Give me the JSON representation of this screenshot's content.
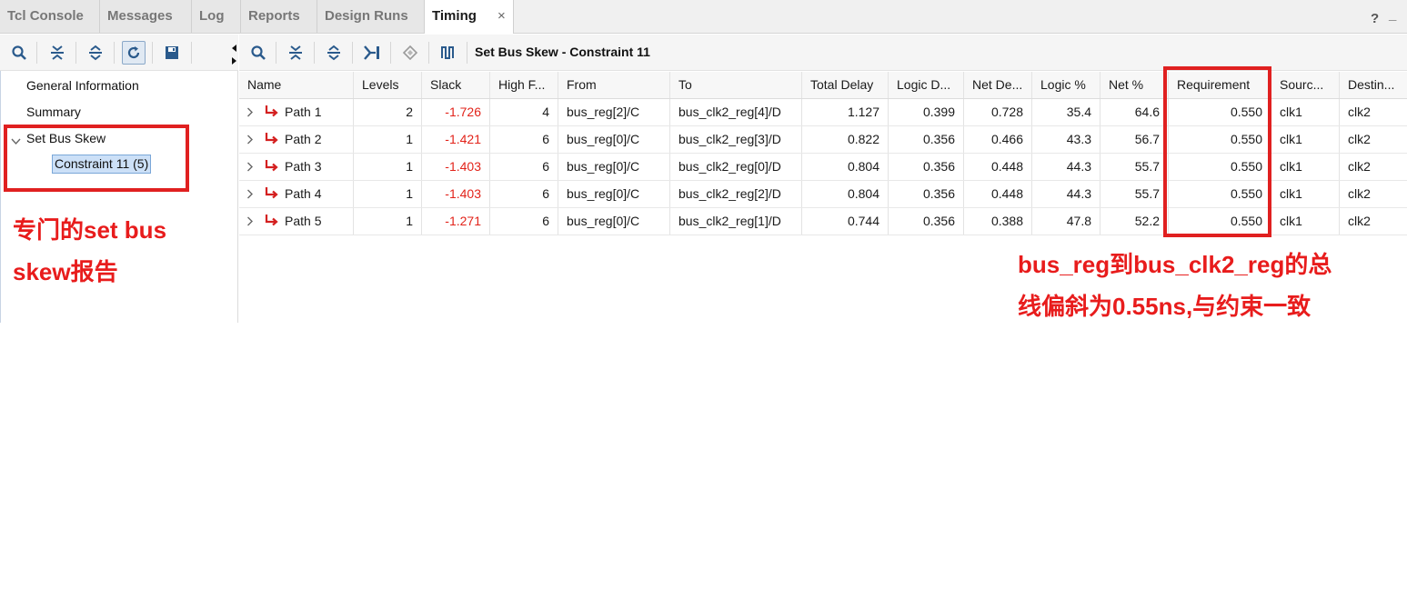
{
  "tabs": [
    {
      "label": "Tcl Console"
    },
    {
      "label": "Messages"
    },
    {
      "label": "Log"
    },
    {
      "label": "Reports"
    },
    {
      "label": "Design Runs"
    },
    {
      "label": "Timing",
      "close": "×"
    }
  ],
  "window_controls": {
    "help": "?",
    "minimize": "_"
  },
  "toolbar_title": "Set Bus Skew - Constraint 11",
  "tree": {
    "general": "General Information",
    "summary": "Summary",
    "set_bus_skew": "Set Bus Skew",
    "constraint": "Constraint 11 (5)"
  },
  "columns": [
    "Name",
    "Levels",
    "Slack",
    "High F...",
    "From",
    "To",
    "Total Delay",
    "Logic D...",
    "Net De...",
    "Logic %",
    "Net %",
    "Requirement",
    "Sourc...",
    "Destin..."
  ],
  "rows": [
    {
      "name": "Path 1",
      "levels": "2",
      "slack": "-1.726",
      "high_fanout": "4",
      "from": "bus_reg[2]/C",
      "to": "bus_clk2_reg[4]/D",
      "total_delay": "1.127",
      "logic_delay": "0.399",
      "net_delay": "0.728",
      "logic_pct": "35.4",
      "net_pct": "64.6",
      "requirement": "0.550",
      "source": "clk1",
      "destination": "clk2"
    },
    {
      "name": "Path 2",
      "levels": "1",
      "slack": "-1.421",
      "high_fanout": "6",
      "from": "bus_reg[0]/C",
      "to": "bus_clk2_reg[3]/D",
      "total_delay": "0.822",
      "logic_delay": "0.356",
      "net_delay": "0.466",
      "logic_pct": "43.3",
      "net_pct": "56.7",
      "requirement": "0.550",
      "source": "clk1",
      "destination": "clk2"
    },
    {
      "name": "Path 3",
      "levels": "1",
      "slack": "-1.403",
      "high_fanout": "6",
      "from": "bus_reg[0]/C",
      "to": "bus_clk2_reg[0]/D",
      "total_delay": "0.804",
      "logic_delay": "0.356",
      "net_delay": "0.448",
      "logic_pct": "44.3",
      "net_pct": "55.7",
      "requirement": "0.550",
      "source": "clk1",
      "destination": "clk2"
    },
    {
      "name": "Path 4",
      "levels": "1",
      "slack": "-1.403",
      "high_fanout": "6",
      "from": "bus_reg[0]/C",
      "to": "bus_clk2_reg[2]/D",
      "total_delay": "0.804",
      "logic_delay": "0.356",
      "net_delay": "0.448",
      "logic_pct": "44.3",
      "net_pct": "55.7",
      "requirement": "0.550",
      "source": "clk1",
      "destination": "clk2"
    },
    {
      "name": "Path 5",
      "levels": "1",
      "slack": "-1.271",
      "high_fanout": "6",
      "from": "bus_reg[0]/C",
      "to": "bus_clk2_reg[1]/D",
      "total_delay": "0.744",
      "logic_delay": "0.356",
      "net_delay": "0.388",
      "logic_pct": "47.8",
      "net_pct": "52.2",
      "requirement": "0.550",
      "source": "clk1",
      "destination": "clk2"
    }
  ],
  "annotations": {
    "left_line1": "专门的set bus",
    "left_line2": "skew报告",
    "right_line1": "bus_reg到bus_clk2_reg的总",
    "right_line2": "线偏斜为0.55ns,与约束一致"
  },
  "colors": {
    "annotation": "#e81c1c",
    "negative_slack": "#e2231a",
    "path_arrow": "#d42020",
    "accent": "#2a5a8c"
  },
  "icons": {
    "left_toolbar": [
      "search-icon",
      "collapse-all-icon",
      "expand-all-icon",
      "refresh-icon",
      "save-icon"
    ],
    "main_toolbar": [
      "search-icon",
      "collapse-all-icon",
      "expand-all-icon",
      "export-icon",
      "diamond-icon",
      "waveform-icon"
    ],
    "row": [
      "chevron-right-icon",
      "path-arrow-icon"
    ]
  }
}
